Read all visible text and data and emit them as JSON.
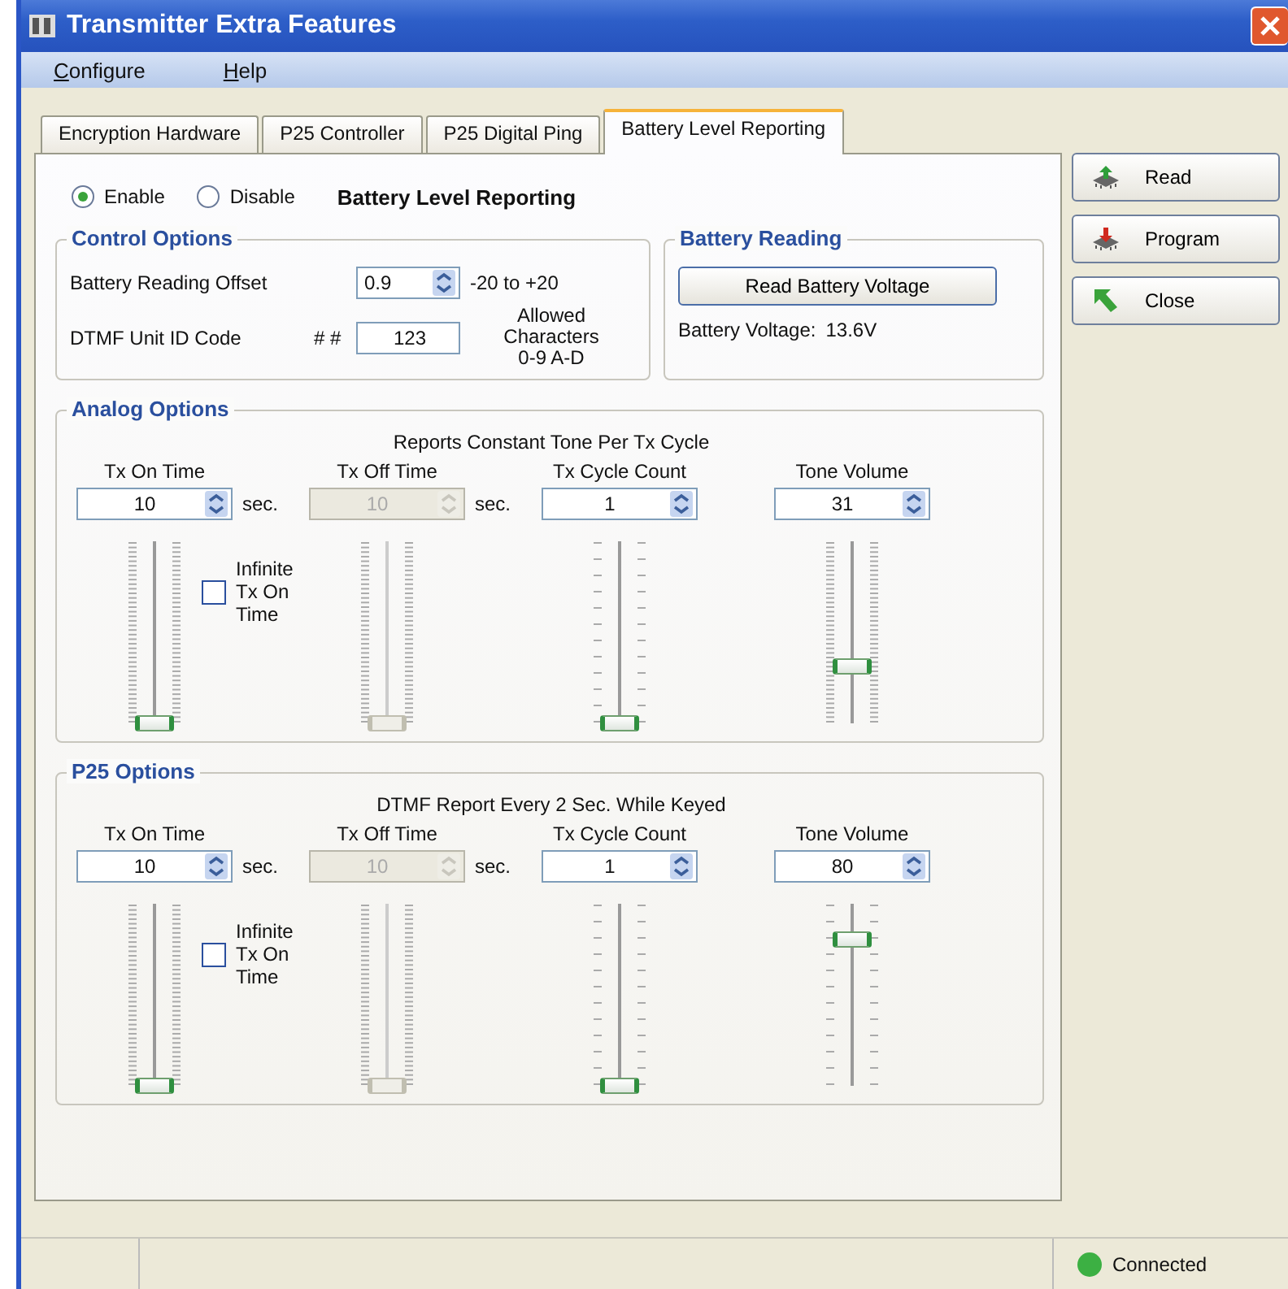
{
  "window": {
    "title": "Transmitter Extra Features"
  },
  "menu": [
    {
      "label": "Configure"
    },
    {
      "label": "Help"
    }
  ],
  "tabs": [
    {
      "label": "Encryption Hardware",
      "selected": false
    },
    {
      "label": "P25 Controller",
      "selected": false
    },
    {
      "label": "P25 Digital Ping",
      "selected": false
    },
    {
      "label": "Battery Level Reporting",
      "selected": true
    }
  ],
  "mode": {
    "options": [
      {
        "label": "Enable",
        "selected": true
      },
      {
        "label": "Disable",
        "selected": false
      }
    ],
    "title": "Battery Level Reporting"
  },
  "control_options": {
    "title": "Control Options",
    "offset_label": "Battery Reading Offset",
    "offset_value": "0.9",
    "offset_range": "-20 to +20",
    "dtmf_label": "DTMF Unit ID Code",
    "dtmf_prefix": "# #",
    "dtmf_value": "123",
    "allowed_label": "Allowed Characters",
    "allowed_chars": "0-9 A-D"
  },
  "battery_reading": {
    "title": "Battery Reading",
    "button": "Read Battery Voltage",
    "voltage_label": "Battery Voltage:",
    "voltage_value": "13.6V"
  },
  "sections": [
    {
      "title": "Analog Options",
      "caption": "Reports Constant Tone Per Tx Cycle",
      "checkbox": {
        "label": "Infinite Tx On Time",
        "checked": false
      },
      "controls": [
        {
          "label": "Tx On Time",
          "value": "10",
          "unit": "sec.",
          "disabled": false,
          "level": 0,
          "kind": "fine"
        },
        {
          "label": "Tx Off Time",
          "value": "10",
          "unit": "sec.",
          "disabled": true,
          "level": 0,
          "kind": "fine"
        },
        {
          "label": "Tx Cycle Count",
          "value": "1",
          "disabled": false,
          "level": 0,
          "kind": "coarse"
        },
        {
          "label": "Tone Volume",
          "value": "31",
          "disabled": false,
          "level": 0.31,
          "kind": "fine"
        }
      ]
    },
    {
      "title": "P25 Options",
      "caption": "DTMF Report Every 2 Sec. While Keyed",
      "checkbox": {
        "label": "Infinite Tx On Time",
        "checked": false
      },
      "controls": [
        {
          "label": "Tx On Time",
          "value": "10",
          "unit": "sec.",
          "disabled": false,
          "level": 0,
          "kind": "fine"
        },
        {
          "label": "Tx Off Time",
          "value": "10",
          "unit": "sec.",
          "disabled": true,
          "level": 0,
          "kind": "fine"
        },
        {
          "label": "Tx Cycle Count",
          "value": "1",
          "disabled": false,
          "level": 0,
          "kind": "coarse"
        },
        {
          "label": "Tone Volume",
          "value": "80",
          "disabled": false,
          "level": 0.8,
          "kind": "coarse"
        }
      ]
    }
  ],
  "side_buttons": [
    {
      "label": "Read",
      "kind": "read"
    },
    {
      "label": "Program",
      "kind": "program"
    },
    {
      "label": "Close",
      "kind": "close"
    }
  ],
  "status_bar": {
    "connection": "Connected",
    "color": "#3cb043"
  }
}
